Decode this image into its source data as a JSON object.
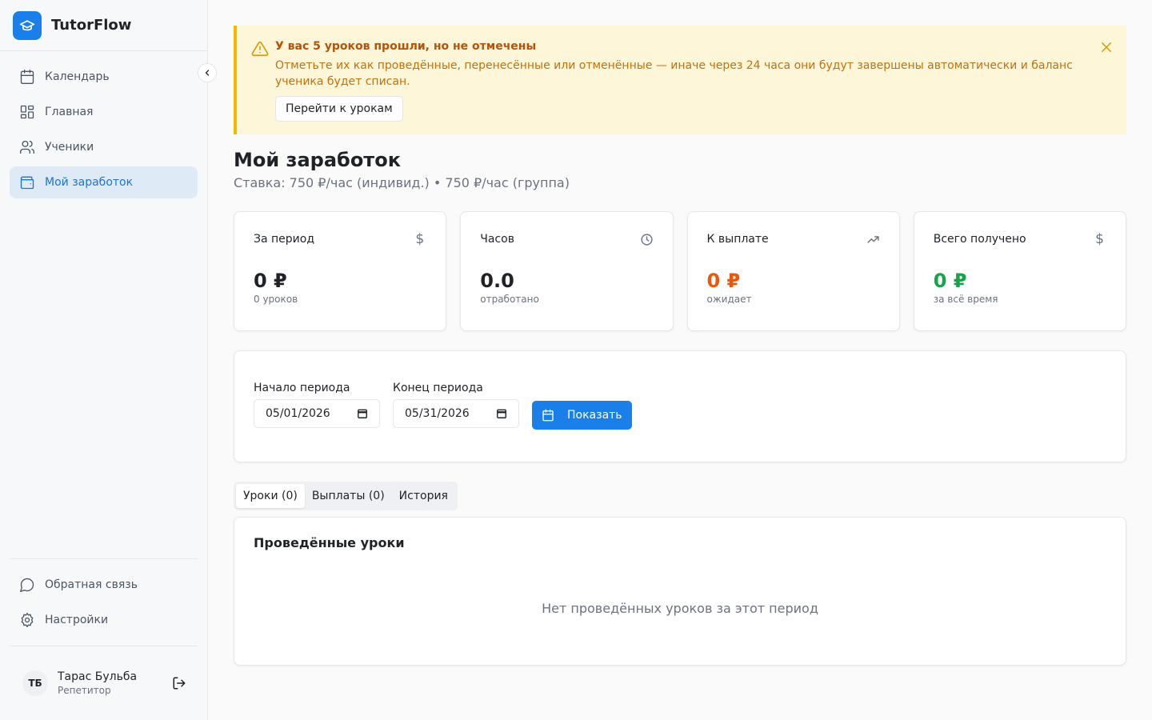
{
  "app": {
    "name": "TutorFlow"
  },
  "nav": {
    "items": [
      {
        "label": "Календарь",
        "icon": "calendar-icon",
        "active": false
      },
      {
        "label": "Главная",
        "icon": "dashboard-icon",
        "active": false
      },
      {
        "label": "Ученики",
        "icon": "users-icon",
        "active": false
      },
      {
        "label": "Мой заработок",
        "icon": "wallet-icon",
        "active": true
      }
    ],
    "bottom": [
      {
        "label": "Обратная связь",
        "icon": "message-icon"
      },
      {
        "label": "Настройки",
        "icon": "gear-icon"
      }
    ]
  },
  "user": {
    "initials": "ТБ",
    "name": "Тарас Бульба",
    "role": "Репетитор"
  },
  "alert": {
    "title": "У вас 5 уроков прошли, но не отмечены",
    "text": "Отметьте их как проведённые, перенесённые или отменённые — иначе через 24 часа они будут завершены автоматически и баланс ученика будет списан.",
    "button": "Перейти к урокам"
  },
  "page": {
    "title": "Мой заработок",
    "subtitle": "Ставка: 750 ₽/час (индивид.) • 750 ₽/час (группа)"
  },
  "cards": [
    {
      "label": "За период",
      "icon": "dollar-icon",
      "value": "0 ₽",
      "note": "0 уроков",
      "color": "#1f2328"
    },
    {
      "label": "Часов",
      "icon": "clock-icon",
      "value": "0.0",
      "note": "отработано",
      "color": "#1f2328"
    },
    {
      "label": "К выплате",
      "icon": "trending-up-icon",
      "value": "0 ₽",
      "note": "ожидает",
      "color": "#ea580c"
    },
    {
      "label": "Всего получено",
      "icon": "dollar-icon",
      "value": "0 ₽",
      "note": "за всё время",
      "color": "#16a34a"
    }
  ],
  "period": {
    "start_label": "Начало периода",
    "start_value": "05/01/2026",
    "end_label": "Конец периода",
    "end_value": "05/31/2026",
    "show_button": "Показать"
  },
  "tabs": [
    {
      "label": "Уроки (0)",
      "active": true
    },
    {
      "label": "Выплаты (0)",
      "active": false
    },
    {
      "label": "История",
      "active": false
    }
  ],
  "lessons": {
    "title": "Проведённые уроки",
    "empty": "Нет проведённых уроков за этот период"
  }
}
